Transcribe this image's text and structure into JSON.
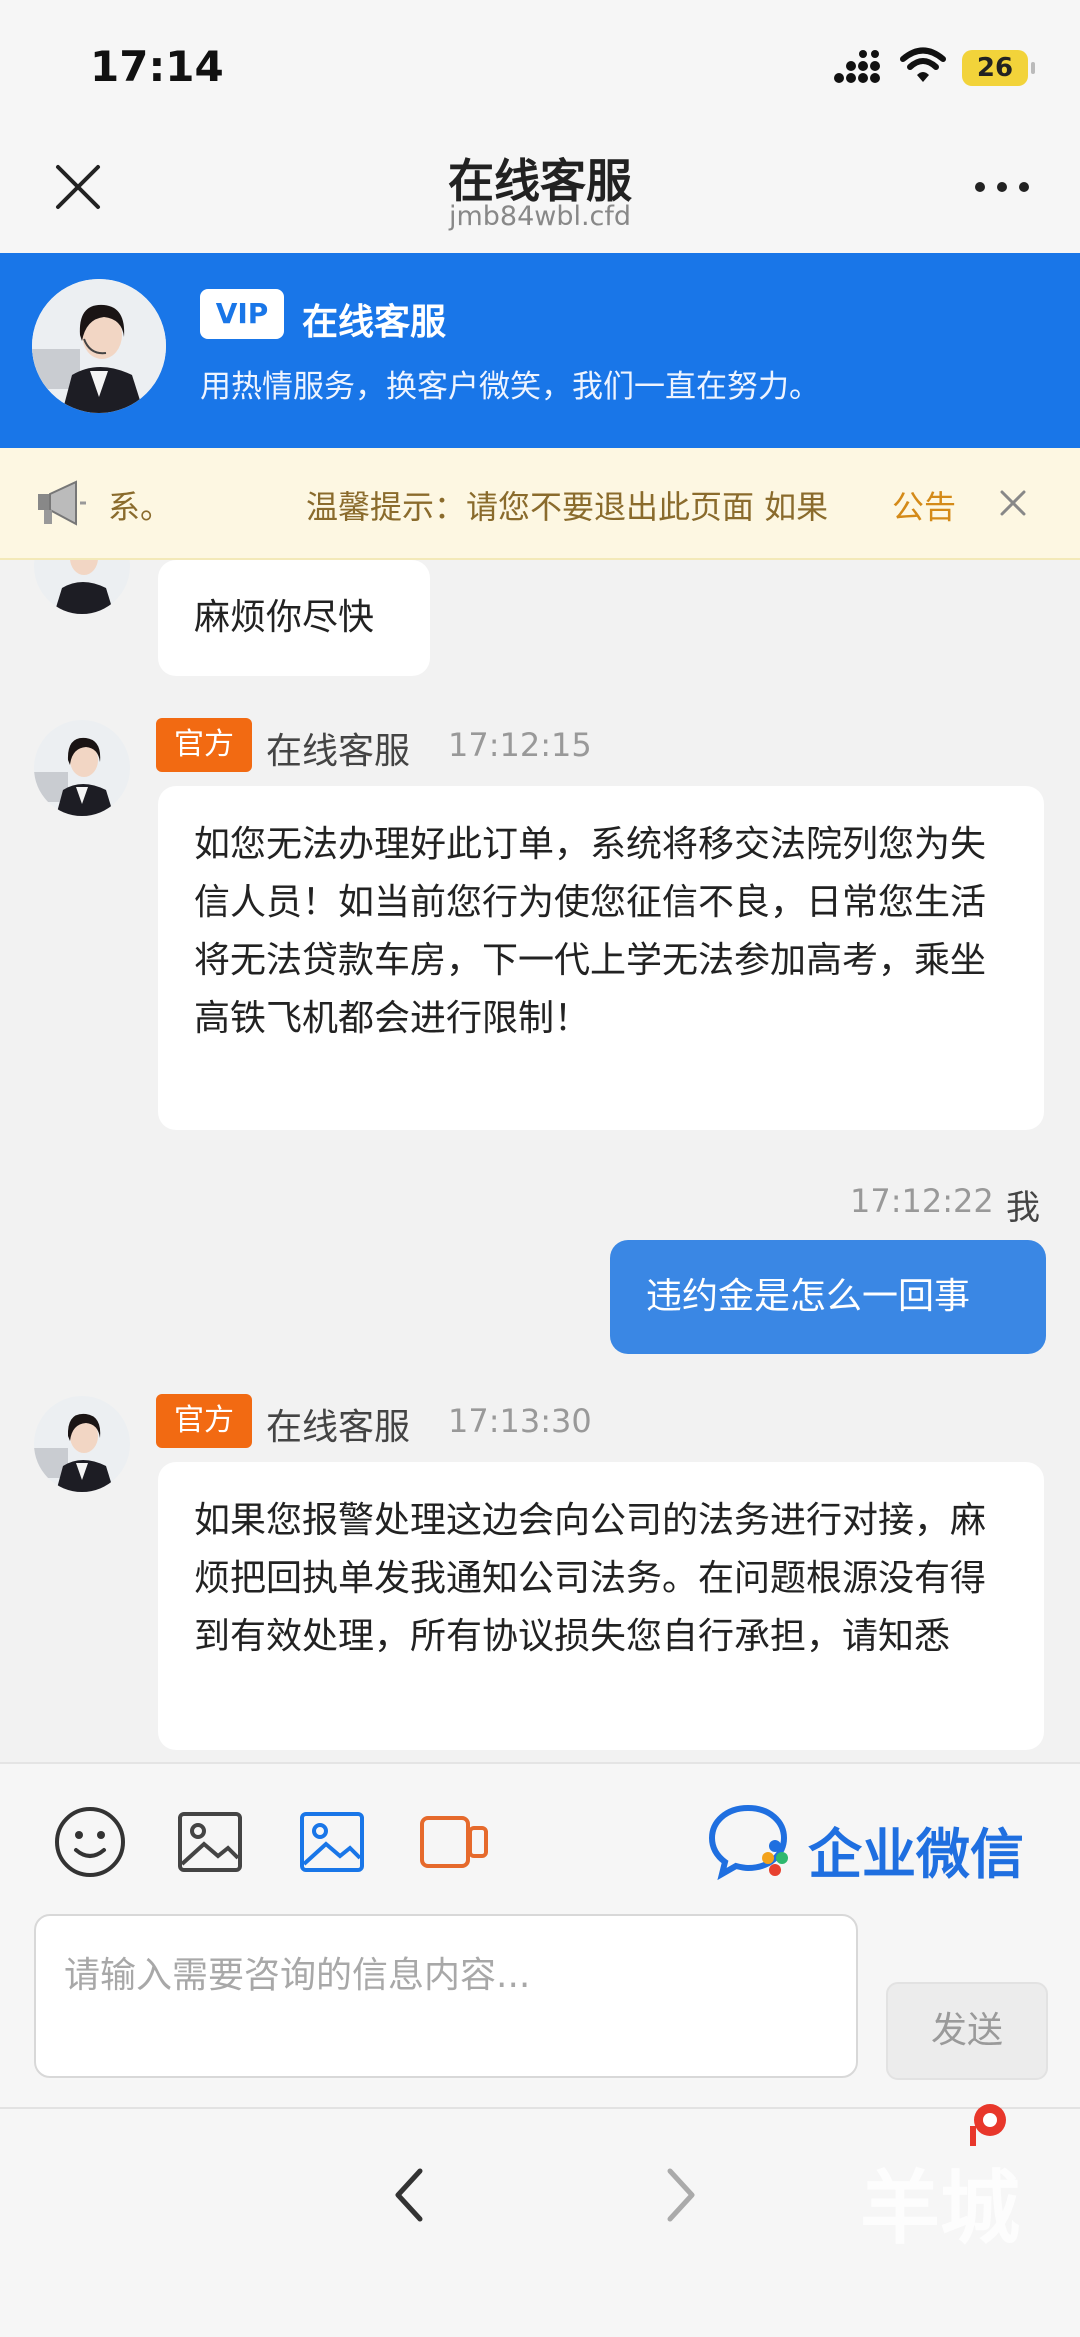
{
  "status_bar": {
    "time": "17:14",
    "battery": "26"
  },
  "nav": {
    "title": "在线客服",
    "url": "jmb84wbl.cfd"
  },
  "banner": {
    "vip": "VIP",
    "title": "在线客服",
    "subtitle": "用热情服务，换客户微笑，我们一直在努力。"
  },
  "notice": {
    "fragment": "系。",
    "text": "温馨提示：请您不要退出此页面 如果",
    "tag": "公告"
  },
  "messages": [
    {
      "side": "in",
      "text": "麻烦你尽快"
    },
    {
      "side": "in",
      "badge": "官方",
      "sender": "在线客服",
      "time": "17:12:15",
      "text": "如您无法办理好此订单，系统将移交法院列您为失信人员！如当前您行为使您征信不良，日常您生活将无法贷款车房，下一代上学无法参加高考，乘坐高铁飞机都会进行限制！"
    },
    {
      "side": "out",
      "sender": "我",
      "time": "17:12:22",
      "text": "违约金是怎么一回事"
    },
    {
      "side": "in",
      "badge": "官方",
      "sender": "在线客服",
      "time": "17:13:30",
      "text": "如果您报警处理这边会向公司的法务进行对接，麻烦把回执单发我通知公司法务。在问题根源没有得到有效处理，所有协议损失您自行承担，请知悉"
    }
  ],
  "toolbar": {
    "icons": [
      "emoji-icon",
      "image-icon",
      "photo-icon",
      "video-icon"
    ],
    "wecom_label": "企业微信",
    "accent": "#1976e8"
  },
  "input": {
    "placeholder": "请输入需要咨询的信息内容...",
    "send_label": "发送"
  },
  "watermark": {
    "text": "羊城"
  }
}
